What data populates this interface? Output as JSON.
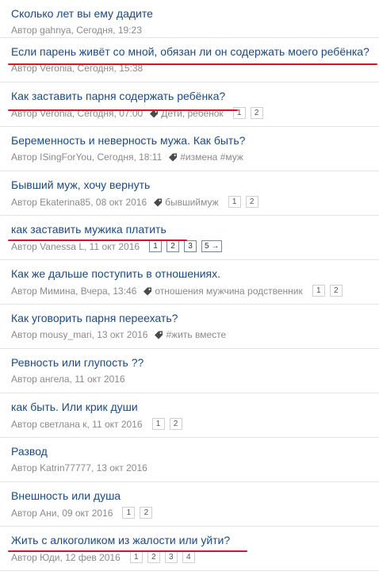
{
  "author_prefix": "Автор",
  "topics": [
    {
      "title": "Сколько лет вы ему дадите",
      "author": "gahnya",
      "date": "Сегодня, 19:23",
      "tag": "",
      "pages": []
    },
    {
      "title": "Если парень живёт со мной, обязан ли он содержать моего ребёнка?",
      "author": "Veronia",
      "date": "Сегодня, 15:38",
      "tag": "",
      "pages": []
    },
    {
      "title": "Как заставить парня содержать ребёнка?",
      "author": "Veronia",
      "date": "Сегодня, 07:00",
      "tag": "Дети, ребенок",
      "pages": [
        "1",
        "2"
      ]
    },
    {
      "title": "Беременность и неверность мужа. Как быть?",
      "author": "ISingForYou",
      "date": "Сегодня, 18:11",
      "tag": "#измена #муж",
      "pages": []
    },
    {
      "title": "Бывший муж, хочу вернуть",
      "author": "Ekaterina85",
      "date": "08 окт 2016",
      "tag": "бывшиймуж",
      "pages": [
        "1",
        "2"
      ]
    },
    {
      "title": "как заставить мужика платить",
      "author": "Vanessa L",
      "date": "11 окт 2016",
      "tag": "",
      "pages": [
        "1",
        "2",
        "3",
        "5 →"
      ]
    },
    {
      "title": "Как же дальше поступить в отношениях.",
      "author": "Мимина",
      "date": "Вчера, 13:46",
      "tag": "отношения мужчина родственник",
      "pages": [
        "1",
        "2"
      ]
    },
    {
      "title": "Как уговорить парня переехать?",
      "author": "mousy_mari",
      "date": "13 окт 2016",
      "tag": "#жить вместе",
      "pages": []
    },
    {
      "title": "Ревность или глупость ??",
      "author": "ангела",
      "date": "11 окт 2016",
      "tag": "",
      "pages": []
    },
    {
      "title": "как быть. Или крик души",
      "author": "светлана к",
      "date": "11 окт 2016",
      "tag": "",
      "pages": [
        "1",
        "2"
      ]
    },
    {
      "title": "Развод",
      "author": "Katrin77777",
      "date": "13 окт 2016",
      "tag": "",
      "pages": []
    },
    {
      "title": "Внешность или душа",
      "author": "Ани",
      "date": "09 окт 2016",
      "tag": "",
      "pages": [
        "1",
        "2"
      ]
    },
    {
      "title": "Жить с алкоголиком из жалости или уйти?",
      "author": "Юди",
      "date": "12 фев 2016",
      "tag": "",
      "pages": [
        "1",
        "2",
        "3",
        "4"
      ]
    }
  ],
  "underline_color": "#d8152a",
  "link_color": "#1a4a80",
  "meta_color": "#8a8a8a"
}
